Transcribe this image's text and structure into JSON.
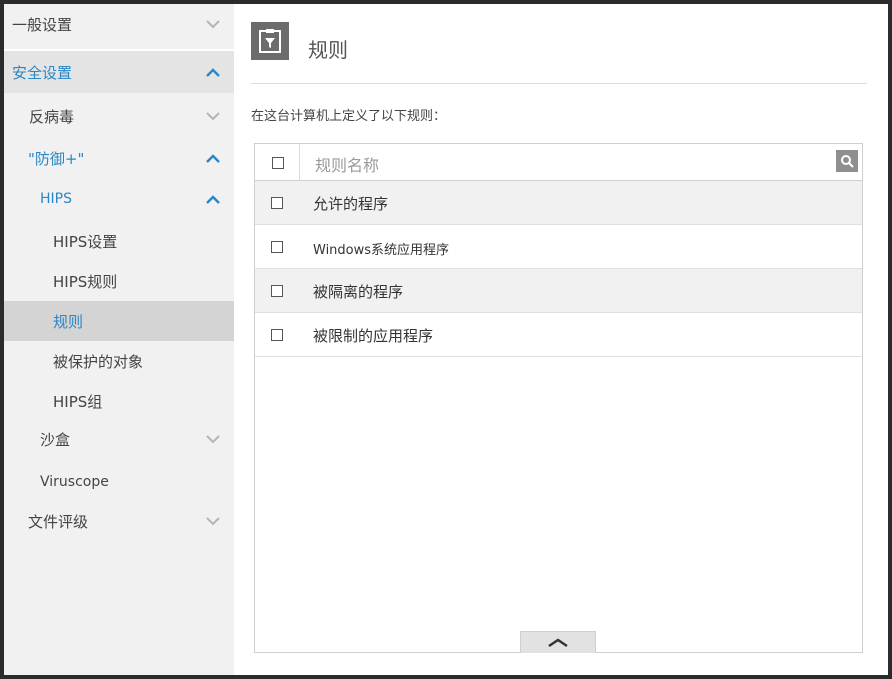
{
  "sidebar": {
    "items": [
      {
        "label": "一般设置",
        "chevron": "down"
      },
      {
        "label": "安全设置",
        "chevron": "up"
      },
      {
        "label": "反病毒",
        "chevron": "down"
      },
      {
        "label": "\"防御+\"",
        "chevron": "up"
      },
      {
        "label": "HIPS",
        "chevron": "up"
      },
      {
        "label": "HIPS设置"
      },
      {
        "label": "HIPS规则"
      },
      {
        "label": "规则",
        "selected": true
      },
      {
        "label": "被保护的对象"
      },
      {
        "label": "HIPS组"
      },
      {
        "label": "沙盒",
        "chevron": "down"
      },
      {
        "label": "Viruscope"
      },
      {
        "label": "文件评级",
        "chevron": "down"
      }
    ]
  },
  "header": {
    "icon": "filter-document-icon",
    "title": "规则"
  },
  "description": "在这台计算机上定义了以下规则：",
  "table": {
    "column_header": "规则名称",
    "search_icon": "search-icon",
    "rows": [
      "允许的程序",
      "Windows系统应用程序",
      "被隔离的程序",
      "被限制的应用程序"
    ],
    "collapse_icon": "chevron-up-icon"
  },
  "colors": {
    "accent": "#2a86c6",
    "sidebar_bg": "#f1f1f1",
    "selected_bg": "#d4d4d4",
    "icon_bg": "#6c6c6c"
  }
}
